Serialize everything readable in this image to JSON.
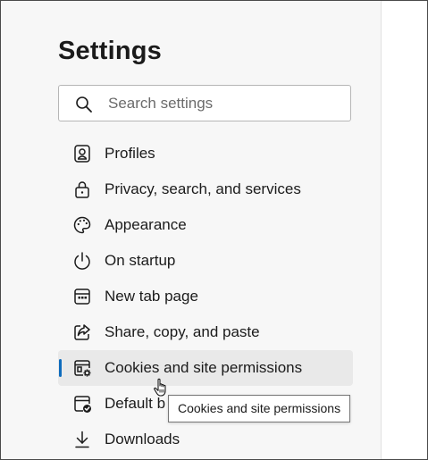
{
  "header": {
    "title": "Settings"
  },
  "search": {
    "placeholder": "Search settings",
    "value": ""
  },
  "sidebar": {
    "items": [
      {
        "label": "Profiles",
        "icon": "profile-icon",
        "active": false
      },
      {
        "label": "Privacy, search, and services",
        "icon": "lock-icon",
        "active": false
      },
      {
        "label": "Appearance",
        "icon": "palette-icon",
        "active": false
      },
      {
        "label": "On startup",
        "icon": "power-icon",
        "active": false
      },
      {
        "label": "New tab page",
        "icon": "new-tab-icon",
        "active": false
      },
      {
        "label": "Share, copy, and paste",
        "icon": "share-icon",
        "active": false
      },
      {
        "label": "Cookies and site permissions",
        "icon": "cookie-permissions-icon",
        "active": true
      },
      {
        "label": "Default b",
        "icon": "default-browser-icon",
        "active": false
      },
      {
        "label": "Downloads",
        "icon": "download-icon",
        "active": false
      }
    ]
  },
  "tooltip": {
    "text": "Cookies and site permissions"
  },
  "colors": {
    "accent": "#0f6cbd",
    "active_background": "#e9e9e9",
    "sidebar_background": "#f7f7f7"
  }
}
